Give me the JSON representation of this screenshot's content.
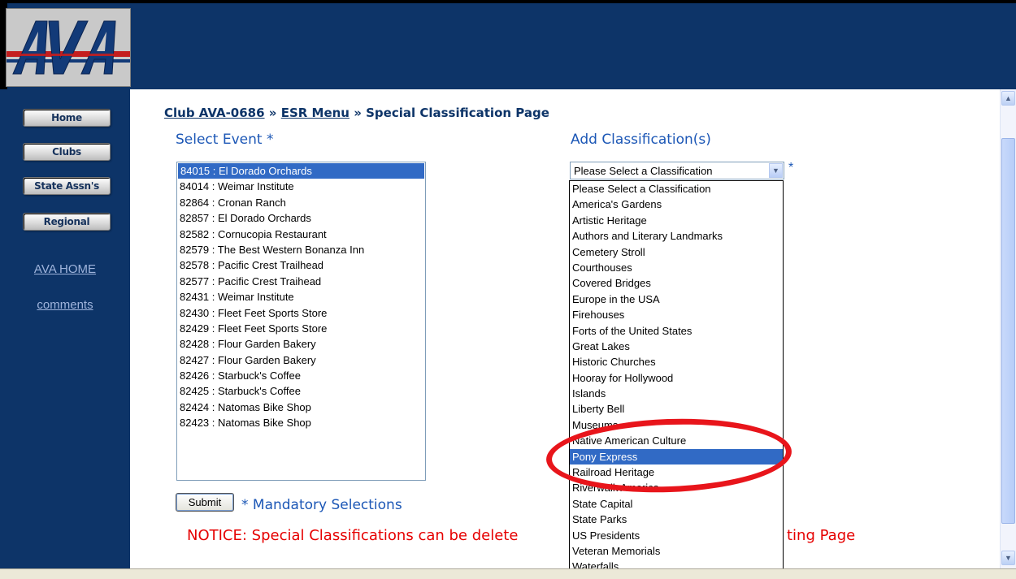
{
  "logo": {
    "text": "AVA"
  },
  "sidebar": {
    "buttons": [
      "Home",
      "Clubs",
      "State Assn's",
      "Regional"
    ],
    "links": [
      "AVA HOME",
      "comments"
    ]
  },
  "breadcrumb": {
    "club": "Club AVA-0686",
    "sep1": " » ",
    "menu": "ESR Menu",
    "sep2": " » ",
    "page": "Special Classification Page"
  },
  "event_section": {
    "label": "Select Event *",
    "events": [
      "84015 : El Dorado Orchards",
      "84014 : Weimar Institute",
      "82864 : Cronan Ranch",
      "82857 : El Dorado Orchards",
      "82582 : Cornucopia Restaurant",
      "82579 : The Best Western Bonanza Inn",
      "82578 : Pacific Crest Trailhead",
      "82577 : Pacific Crest Traihead",
      "82431 : Weimar Institute",
      "82430 : Fleet Feet Sports Store",
      "82429 : Fleet Feet Sports Store",
      "82428 : Flour Garden Bakery",
      "82427 : Flour Garden Bakery",
      "82426 : Starbuck's Coffee",
      "82425 : Starbuck's Coffee",
      "82424 : Natomas Bike Shop",
      "82423 : Natomas Bike Shop"
    ],
    "selected_index": 0
  },
  "classification_section": {
    "label": "Add Classification(s)",
    "select_value": "Please Select a Classification",
    "asterisk": "*",
    "options": [
      "Please Select a Classification",
      "America's Gardens",
      "Artistic Heritage",
      "Authors and Literary Landmarks",
      "Cemetery Stroll",
      "Courthouses",
      "Covered Bridges",
      "Europe in the USA",
      "Firehouses",
      "Forts of the United States",
      "Great Lakes",
      "Historic Churches",
      "Hooray for Hollywood",
      "Islands",
      "Liberty Bell",
      "Museums",
      "Native American Culture",
      "Pony Express",
      "Railroad Heritage",
      "Riverwalk America",
      "State Capital",
      "State Parks",
      "US Presidents",
      "Veteran Memorials",
      "Waterfalls"
    ],
    "highlighted_index": 17
  },
  "form": {
    "submit_label": "Submit",
    "mandatory_note": "* Mandatory Selections",
    "notice": "NOTICE: Special Classifications can be delete",
    "notice_tail": "ting Page"
  },
  "colors": {
    "frame_blue": "#0d3468",
    "selection_blue": "#316ac5",
    "notice_red": "#e60000",
    "annotation_red": "#e8151b"
  }
}
